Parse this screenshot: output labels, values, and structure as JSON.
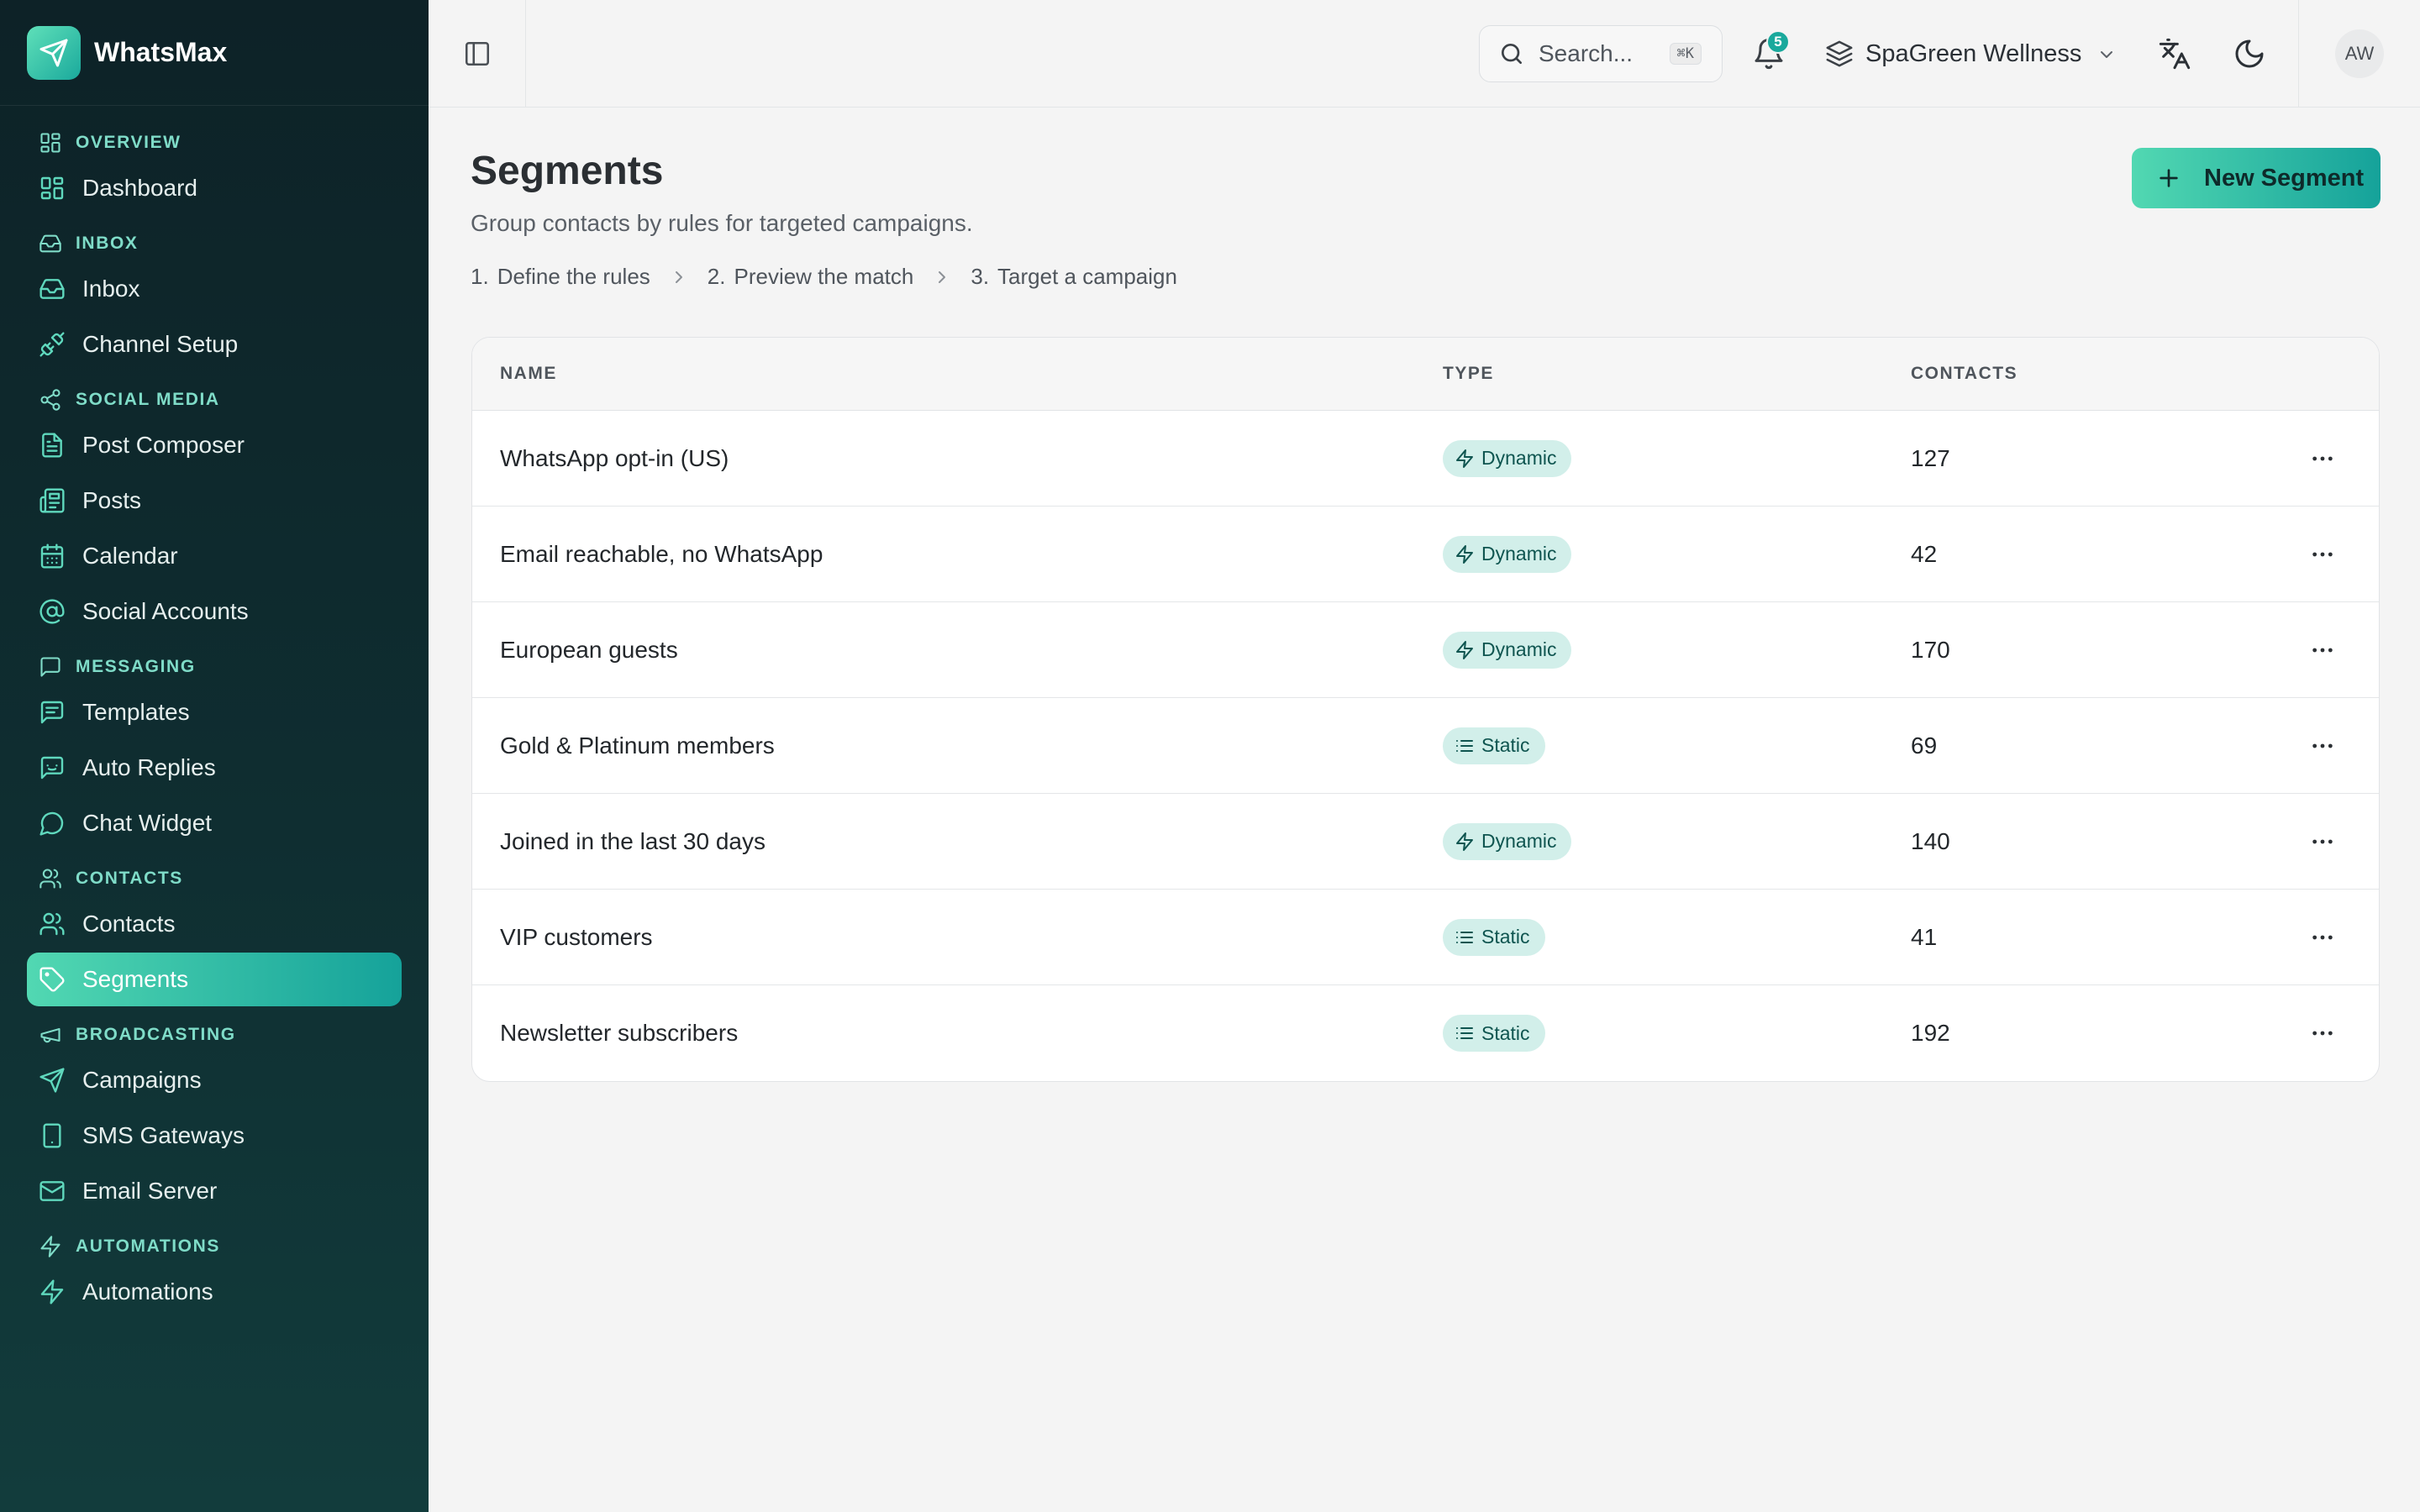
{
  "app": {
    "name": "WhatsMax"
  },
  "sidebar": {
    "sections": [
      {
        "title": "OVERVIEW",
        "icon": "grid-icon",
        "items": [
          {
            "label": "Dashboard",
            "icon": "grid-icon"
          }
        ]
      },
      {
        "title": "INBOX",
        "icon": "inbox-icon",
        "items": [
          {
            "label": "Inbox",
            "icon": "inbox-icon"
          },
          {
            "label": "Channel Setup",
            "icon": "plug-icon"
          }
        ]
      },
      {
        "title": "SOCIAL MEDIA",
        "icon": "share-icon",
        "items": [
          {
            "label": "Post Composer",
            "icon": "document-icon"
          },
          {
            "label": "Posts",
            "icon": "newspaper-icon"
          },
          {
            "label": "Calendar",
            "icon": "calendar-icon"
          },
          {
            "label": "Social Accounts",
            "icon": "at-sign-icon"
          }
        ]
      },
      {
        "title": "MESSAGING",
        "icon": "message-square-icon",
        "items": [
          {
            "label": "Templates",
            "icon": "message-template-icon"
          },
          {
            "label": "Auto Replies",
            "icon": "bot-message-icon"
          },
          {
            "label": "Chat Widget",
            "icon": "chat-bubble-icon"
          }
        ]
      },
      {
        "title": "CONTACTS",
        "icon": "users-icon",
        "items": [
          {
            "label": "Contacts",
            "icon": "users-icon"
          },
          {
            "label": "Segments",
            "icon": "tag-icon",
            "active": true
          }
        ]
      },
      {
        "title": "BROADCASTING",
        "icon": "megaphone-icon",
        "items": [
          {
            "label": "Campaigns",
            "icon": "send-icon"
          },
          {
            "label": "SMS Gateways",
            "icon": "smartphone-icon"
          },
          {
            "label": "Email Server",
            "icon": "mail-icon"
          }
        ]
      },
      {
        "title": "AUTOMATIONS",
        "icon": "zap-icon",
        "items": [
          {
            "label": "Automations",
            "icon": "zap-icon"
          }
        ]
      }
    ]
  },
  "topbar": {
    "search_placeholder": "Search...",
    "search_shortcut": "⌘K",
    "notifications_count": "5",
    "workspace": "SpaGreen Wellness",
    "avatar_initials": "AW"
  },
  "page": {
    "title": "Segments",
    "subtitle": "Group contacts by rules for targeted campaigns.",
    "steps": [
      {
        "num": "1.",
        "label": "Define the rules"
      },
      {
        "num": "2.",
        "label": "Preview the match"
      },
      {
        "num": "3.",
        "label": "Target a campaign"
      }
    ],
    "new_button": "New Segment"
  },
  "table": {
    "columns": [
      "NAME",
      "TYPE",
      "CONTACTS"
    ],
    "rows": [
      {
        "name": "WhatsApp opt-in (US)",
        "type": "Dynamic",
        "contacts": "127"
      },
      {
        "name": "Email reachable, no WhatsApp",
        "type": "Dynamic",
        "contacts": "42"
      },
      {
        "name": "European guests",
        "type": "Dynamic",
        "contacts": "170"
      },
      {
        "name": "Gold & Platinum members",
        "type": "Static",
        "contacts": "69"
      },
      {
        "name": "Joined in the last 30 days",
        "type": "Dynamic",
        "contacts": "140"
      },
      {
        "name": "VIP customers",
        "type": "Static",
        "contacts": "41"
      },
      {
        "name": "Newsletter subscribers",
        "type": "Static",
        "contacts": "192"
      }
    ]
  },
  "colors": {
    "sidebar_bg": "#0f2e31",
    "accent_start": "#52d8b2",
    "accent_end": "#15a29a",
    "pill_bg": "#d2efea",
    "pill_text": "#0f5550"
  }
}
